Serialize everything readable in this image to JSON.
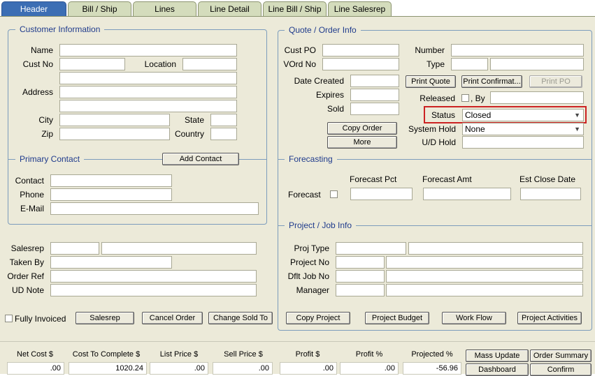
{
  "tabs": [
    "Header",
    "Bill / Ship",
    "Lines",
    "Line Detail",
    "Line Bill / Ship",
    "Line Salesrep"
  ],
  "customer": {
    "legend": "Customer Information",
    "name_label": "Name",
    "cust_no_label": "Cust No",
    "location_label": "Location",
    "address_label": "Address",
    "city_label": "City",
    "state_label": "State",
    "zip_label": "Zip",
    "country_label": "Country"
  },
  "contact": {
    "legend": "Primary Contact",
    "add_button": "Add Contact",
    "contact_label": "Contact",
    "phone_label": "Phone",
    "email_label": "E-Mail"
  },
  "order_misc": {
    "salesrep_label": "Salesrep",
    "taken_by_label": "Taken By",
    "order_ref_label": "Order Ref",
    "ud_note_label": "UD Note",
    "fully_invoiced_label": "Fully Invoiced",
    "salesrep_button": "Salesrep",
    "cancel_button": "Cancel Order",
    "change_sold_button": "Change Sold To"
  },
  "quote": {
    "legend": "Quote / Order Info",
    "cust_po_label": "Cust PO",
    "vord_label": "VOrd No",
    "number_label": "Number",
    "type_label": "Type",
    "date_created_label": "Date Created",
    "expires_label": "Expires",
    "sold_label": "Sold",
    "print_quote": "Print Quote",
    "print_confirm": "Print Confirmat...",
    "print_po": "Print PO",
    "released_label": "Released",
    "by_label": ", By",
    "status_label": "Status",
    "status_value": "Closed",
    "copy_order": "Copy Order",
    "more": "More",
    "system_hold_label": "System Hold",
    "system_hold_value": "None",
    "ud_hold_label": "U/D Hold"
  },
  "forecast": {
    "legend": "Forecasting",
    "forecast_label": "Forecast",
    "pct_label": "Forecast Pct",
    "amt_label": "Forecast Amt",
    "close_label": "Est Close Date"
  },
  "project": {
    "legend": "Project / Job Info",
    "proj_type_label": "Proj Type",
    "project_no_label": "Project No",
    "dflt_job_label": "Dflt Job No",
    "manager_label": "Manager",
    "copy_project": "Copy Project",
    "project_budget": "Project Budget",
    "work_flow": "Work Flow",
    "project_activities": "Project Activities"
  },
  "totals": {
    "labels": [
      "Net Cost $",
      "Cost To Complete $",
      "List Price $",
      "Sell Price $",
      "Profit $",
      "Profit %",
      "Projected %"
    ],
    "values": [
      ".00",
      "1020.24",
      ".00",
      ".00",
      ".00",
      ".00",
      "-56.96"
    ]
  },
  "actions": {
    "mass_update": "Mass Update",
    "order_summary": "Order Summary",
    "dashboard": "Dashboard",
    "confirm": "Confirm"
  },
  "colors": {
    "tab_active": "#3c6eb4",
    "panel_bg": "#ecead9",
    "legend_text": "#1f3b8c",
    "highlight": "#cc2222"
  }
}
